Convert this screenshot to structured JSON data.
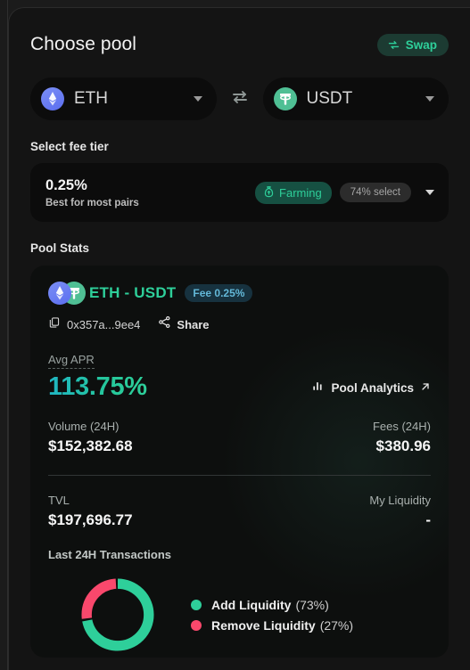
{
  "header": {
    "title": "Choose pool",
    "swap_label": "Swap",
    "swap_icon": "swap-circular-arrows-icon"
  },
  "tokens": {
    "from": {
      "symbol": "ETH",
      "icon": "ethereum-token-icon"
    },
    "to": {
      "symbol": "USDT",
      "icon": "tether-token-icon"
    },
    "switch_icon": "switch-arrows-icon"
  },
  "fee_tier": {
    "section_label": "Select fee tier",
    "percent": "0.25%",
    "description": "Best for most pairs",
    "farming_badge": "Farming",
    "farming_icon": "money-bag-icon",
    "select_badge": "74% select",
    "chevron_icon": "chevron-down-icon"
  },
  "pool_stats": {
    "section_label": "Pool Stats",
    "pair_name": "ETH - USDT",
    "fee_pill": "Fee 0.25%",
    "address": "0x357a...9ee4",
    "copy_icon": "copy-icon",
    "share_label": "Share",
    "share_icon": "share-nodes-icon",
    "apr_label": "Avg APR",
    "apr_value": "113.75%",
    "analytics_label": "Pool Analytics",
    "analytics_icon": "bar-chart-icon",
    "external_link_icon": "external-link-arrow-icon",
    "volume_label": "Volume (24H)",
    "volume_value": "$152,382.68",
    "fees_label": "Fees (24H)",
    "fees_value": "$380.96",
    "tvl_label": "TVL",
    "tvl_value": "$197,696.77",
    "my_liquidity_label": "My Liquidity",
    "my_liquidity_value": "-",
    "transactions_label": "Last 24H Transactions"
  },
  "chart_data": {
    "type": "pie",
    "title": "Last 24H Transactions",
    "categories": [
      "Add Liquidity",
      "Remove Liquidity"
    ],
    "values": [
      73,
      27
    ],
    "labels": [
      "Add Liquidity (73%)",
      "Remove Liquidity (27%)"
    ],
    "colors": [
      "#2ecf9a",
      "#f9486c"
    ],
    "legend_position": "right",
    "donut": true
  },
  "legend": [
    {
      "name": "Add Liquidity",
      "pct": "(73%)",
      "color": "#2ecf9a"
    },
    {
      "name": "Remove Liquidity",
      "pct": "(27%)",
      "color": "#f9486c"
    }
  ],
  "colors": {
    "accent_green": "#2ecf9a",
    "accent_pink": "#f9486c",
    "panel_bg": "#141414",
    "card_bg": "#0d0f0e"
  }
}
